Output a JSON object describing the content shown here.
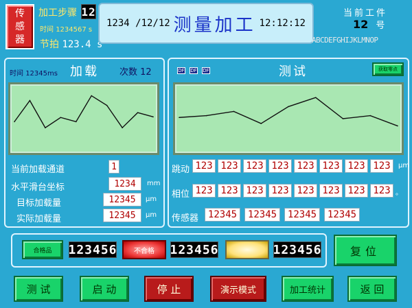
{
  "header": {
    "sensor_button": "传\n感\n器",
    "step_label": "加工步骤",
    "step_value": "12",
    "time_label": "时间",
    "time_value": "1234567 s",
    "beat_label": "节拍",
    "beat_value": "123.4 s",
    "date": "1234 /12/12",
    "title": "测量加工",
    "clock": "12:12:12",
    "current_label": "当前工件",
    "current_number": "12",
    "current_unit": "号",
    "alphabet": "ABCDEFGHIJKLMNOP"
  },
  "load_panel": {
    "time_label": "时间",
    "time_value": "12345ms",
    "title": "加载",
    "count_label": "次数",
    "count_value": "12",
    "channel_label": "当前加载通道",
    "channel_value": "1",
    "slide_label": "水平滑台坐标",
    "slide_value": "1234",
    "slide_unit": "mm",
    "target_label": "目标加载量",
    "target_value": "12345",
    "target_unit": "μm",
    "actual_label": "实际加载量",
    "actual_value": "12345",
    "actual_unit": "μm"
  },
  "test_panel": {
    "title": "测试",
    "df1": "DF",
    "df2": "DF",
    "df3": "DF",
    "capture_button": "获取零点",
    "runout_label": "跳动",
    "runout_values": [
      "123",
      "123",
      "123",
      "123",
      "123",
      "123",
      "123",
      "123"
    ],
    "runout_unit": "μm",
    "phase_label": "相位",
    "phase_values": [
      "123",
      "123",
      "123",
      "123",
      "123",
      "123",
      "123",
      "123"
    ],
    "phase_unit": "。",
    "sensor_label": "传感器",
    "sensor_values": [
      "12345",
      "12345",
      "12345",
      "12345"
    ]
  },
  "status_bar": {
    "counter_button": "合格品",
    "counter1": "123456",
    "red_button": "不合格",
    "counter2": "123456",
    "yellow_button": "",
    "counter3": "123456",
    "reset_button": "复位"
  },
  "bottom_buttons": {
    "test": "测 试",
    "start": "启 动",
    "stop": "停 止",
    "demo": "演示模式",
    "stats": "加工统计",
    "back": "返 回"
  },
  "chart_data": [
    {
      "type": "line",
      "title": "",
      "values": [
        45,
        80,
        35,
        52,
        45,
        88,
        72,
        35,
        60,
        53
      ]
    },
    {
      "type": "line",
      "title": "",
      "values": [
        52,
        55,
        62,
        42,
        70,
        85,
        50,
        55,
        38
      ]
    }
  ]
}
